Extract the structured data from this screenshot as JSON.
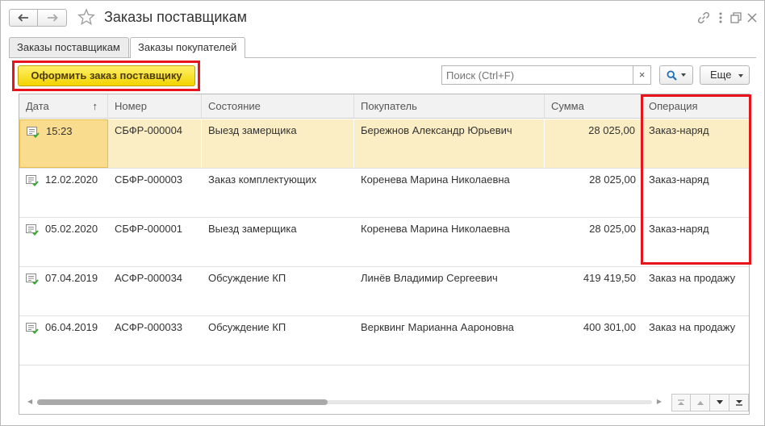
{
  "window": {
    "title": "Заказы поставщикам"
  },
  "tabs": [
    {
      "label": "Заказы поставщикам",
      "active": false
    },
    {
      "label": "Заказы покупателей",
      "active": true
    }
  ],
  "toolbar": {
    "primary_label": "Оформить заказ поставщику",
    "search_placeholder": "Поиск (Ctrl+F)",
    "search_clear": "×",
    "more_label": "Еще"
  },
  "table": {
    "columns": [
      "Дата",
      "Номер",
      "Состояние",
      "Покупатель",
      "Сумма",
      "Операция"
    ],
    "sort_indicator": "↑",
    "rows": [
      {
        "date": "15:23",
        "number": "СБФР-000004",
        "state": "Выезд замерщика",
        "customer": "Бережнов Александр Юрьевич",
        "sum": "28 025,00",
        "operation": "Заказ-наряд",
        "selected": true
      },
      {
        "date": "12.02.2020",
        "number": "СБФР-000003",
        "state": "Заказ комплектующих",
        "customer": "Коренева Марина Николаевна",
        "sum": "28 025,00",
        "operation": "Заказ-наряд",
        "selected": false
      },
      {
        "date": "05.02.2020",
        "number": "СБФР-000001",
        "state": "Выезд замерщика",
        "customer": "Коренева Марина Николаевна",
        "sum": "28 025,00",
        "operation": "Заказ-наряд",
        "selected": false
      },
      {
        "date": "07.04.2019",
        "number": "АСФР-000034",
        "state": "Обсуждение КП",
        "customer": "Линёв Владимир Сергеевич",
        "sum": "419 419,50",
        "operation": "Заказ на продажу",
        "selected": false
      },
      {
        "date": "06.04.2019",
        "number": "АСФР-000033",
        "state": "Обсуждение КП",
        "customer": "Верквинг Марианна Аароновна",
        "sum": "400 301,00",
        "operation": "Заказ на продажу",
        "selected": false
      }
    ]
  },
  "colors": {
    "primary_button": "#f3d300",
    "highlight_frame": "#e8141c",
    "selected_row": "#fbeec5",
    "doc_icon_arrow": "#3aa935"
  },
  "icons": {
    "nav_back": "arrow-left-icon",
    "nav_forward": "arrow-right-icon",
    "favorite": "star-icon",
    "link": "link-icon",
    "menu": "more-vertical-icon",
    "restore": "restore-window-icon",
    "close": "close-icon",
    "search": "search-icon",
    "document": "document-posted-icon"
  }
}
